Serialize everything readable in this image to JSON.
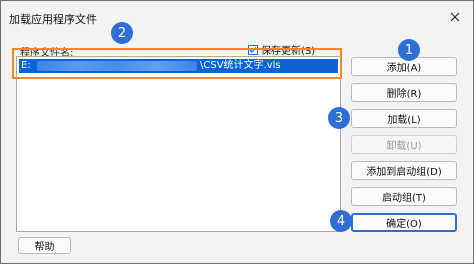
{
  "window": {
    "title": "加载应用程序文件",
    "close_icon": "close-icon"
  },
  "files": {
    "label": "程序文件名:",
    "selected_row": {
      "drive": "E:",
      "filename": "\\CSV统计文字.vls"
    }
  },
  "save_changes": {
    "label": "保存更新(S)",
    "checked": true
  },
  "buttons": {
    "add": "添加(A)",
    "delete": "删除(R)",
    "load": "加载(L)",
    "unload": "卸载(U)",
    "add_to_startup": "添加到启动组(D)",
    "startup_group": "启动组(T)",
    "ok": "确定(O)",
    "help": "帮助"
  },
  "markers": {
    "m1": "1",
    "m2": "2",
    "m3": "3",
    "m4": "4"
  },
  "colors": {
    "selection": "#0a64d8",
    "highlight_box": "#f0882a",
    "marker": "#2f6dd8"
  }
}
